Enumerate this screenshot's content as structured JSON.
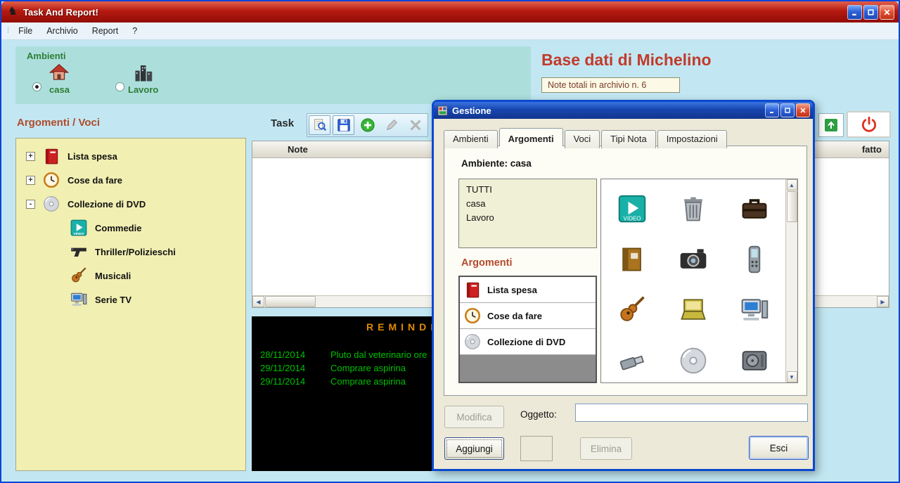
{
  "window": {
    "title": "Task And Report!",
    "menu": [
      "File",
      "Archivio",
      "Report",
      "?"
    ]
  },
  "ambienti": {
    "title": "Ambienti",
    "options": [
      {
        "label": "casa",
        "icon": "house-icon",
        "selected": true
      },
      {
        "label": "Lavoro",
        "icon": "city-icon",
        "selected": false
      }
    ]
  },
  "header": {
    "title": "Base dati di Michelino",
    "note_count": "Note totali in archivio n. 6"
  },
  "tree": {
    "title": "Argomenti / Voci",
    "items": [
      {
        "label": "Lista spesa",
        "icon": "book-icon",
        "expander": "+"
      },
      {
        "label": "Cose da fare",
        "icon": "clock-icon",
        "expander": "+"
      },
      {
        "label": "Collezione di DVD",
        "icon": "cd-icon",
        "expander": "-"
      },
      {
        "label": "Commedie",
        "icon": "video-icon"
      },
      {
        "label": "Thriller/Polizieschi",
        "icon": "gun-icon"
      },
      {
        "label": "Musicali",
        "icon": "guitar-icon"
      },
      {
        "label": "Serie TV",
        "icon": "computer-icon"
      }
    ]
  },
  "task": {
    "label": "Task"
  },
  "table": {
    "col_note": "Note",
    "col_fatto": "fatto"
  },
  "reminder": {
    "title": "REMINDER",
    "entries": [
      {
        "date": "28/11/2014",
        "text": "Pluto dal veterinario ore"
      },
      {
        "date": "29/11/2014",
        "text": "Comprare aspirina"
      },
      {
        "date": "29/11/2014",
        "text": "Comprare aspirina"
      }
    ]
  },
  "dialog": {
    "title": "Gestione",
    "tabs": [
      "Ambienti",
      "Argomenti",
      "Voci",
      "Tipi Nota",
      "Impostazioni"
    ],
    "active_tab": "Argomenti",
    "ambiente_caption": "Ambiente: casa",
    "ambienti_list": [
      "TUTTI",
      "casa",
      "Lavoro"
    ],
    "argomenti_caption": "Argomenti",
    "argomenti_list": [
      {
        "label": "Lista spesa",
        "icon": "book-icon"
      },
      {
        "label": "Cose da fare",
        "icon": "clock-icon"
      },
      {
        "label": "Collezione di DVD",
        "icon": "cd-icon"
      }
    ],
    "icon_grid": [
      "video-icon",
      "trash-icon",
      "briefcase-icon",
      "album-icon",
      "camera-icon",
      "phone-icon",
      "guitar-icon",
      "laptop-icon",
      "computer-icon",
      "usb-icon",
      "cd-icon",
      "harddisk-icon"
    ],
    "oggetto_label": "Oggetto:",
    "oggetto_value": "",
    "buttons": {
      "modifica": "Modifica",
      "aggiungi": "Aggiungi",
      "elimina": "Elimina",
      "esci": "Esci"
    }
  },
  "colors": {
    "titlebar_red": "#B51A10",
    "panel_teal": "#ACDFDC",
    "tree_yellow": "#F1EFB2",
    "accent_brown": "#B04A2A",
    "label_green": "#2E7D33",
    "reminder_green": "#00C000",
    "reminder_orange": "#E08A00"
  }
}
